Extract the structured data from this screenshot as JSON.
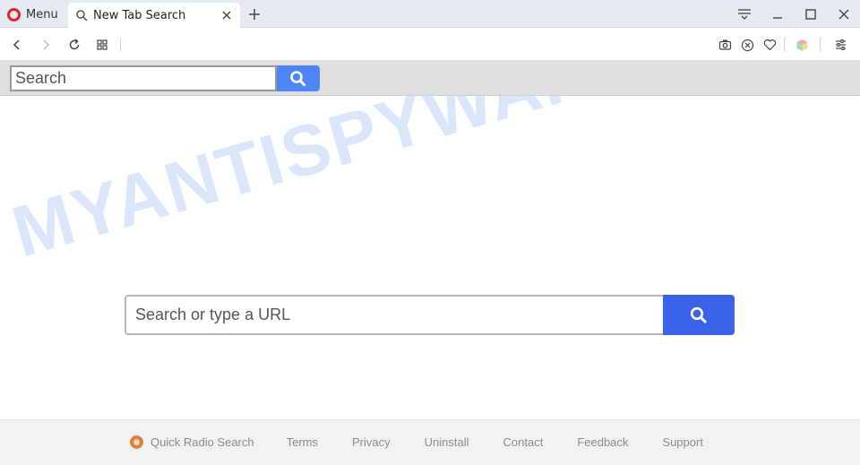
{
  "browser": {
    "menu_label": "Menu",
    "tab_title": "New Tab Search",
    "colors": {
      "opera_red": "#e0232e",
      "tab_strip": "#e6eaf1"
    },
    "window_controls": [
      "easy-setup-icon",
      "minimize-icon",
      "maximize-icon",
      "close-icon"
    ],
    "toolbar_icons": [
      "back-icon",
      "forward-icon",
      "reload-icon",
      "speed-dial-icon",
      "camera-icon",
      "adblock-icon",
      "heart-icon",
      "wallet-icon",
      "settings-icon"
    ]
  },
  "topbar": {
    "search_placeholder": "Search",
    "accent": "#4f86f7"
  },
  "main": {
    "watermark": "MYANTISPYWARE.COM",
    "search_placeholder": "Search or type a URL",
    "accent": "#3b63ea"
  },
  "footer": {
    "brand": "Quick Radio Search",
    "links": [
      "Terms",
      "Privacy",
      "Uninstall",
      "Contact",
      "Feedback",
      "Support"
    ]
  }
}
